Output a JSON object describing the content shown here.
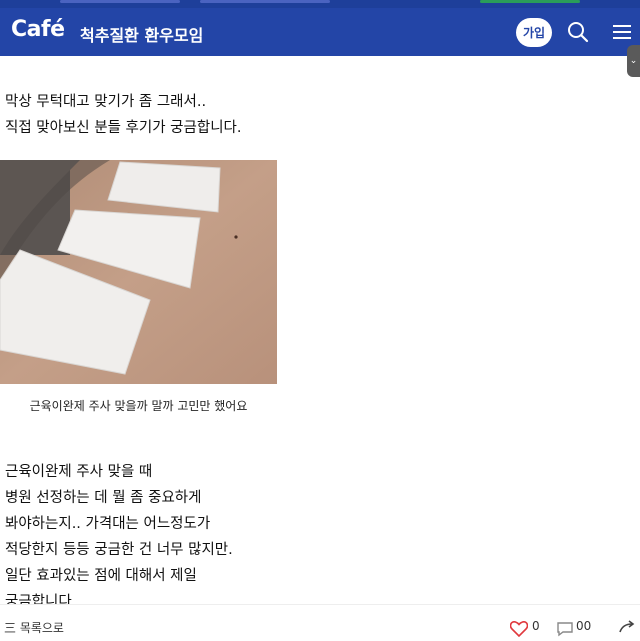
{
  "header": {
    "logo": "Café",
    "cafe_name": "척추질환 환우모임",
    "join_label": "가입"
  },
  "post": {
    "paragraph1": [
      "막상 무턱대고 맞기가 좀 그래서..",
      "직접 맞아보신 분들 후기가 궁금합니다."
    ],
    "image_caption": "근육이완제 주사 맞을까 말까 고민만 했어요",
    "paragraph2": [
      "근육이완제 주사 맞을 때",
      "병원 선정하는 데 뭘 좀 중요하게",
      "봐야하는지.. 가격대는 어느정도가",
      "적당한지 등등 궁금한 건 너무 많지만.",
      "일단 효과있는 점에 대해서 제일",
      "궁금합니다."
    ]
  },
  "bottombar": {
    "left_text": "三 목록으로",
    "like_count": "0",
    "comment_count": "00"
  },
  "colors": {
    "header": "#2345a7",
    "like": "#e0393e"
  }
}
